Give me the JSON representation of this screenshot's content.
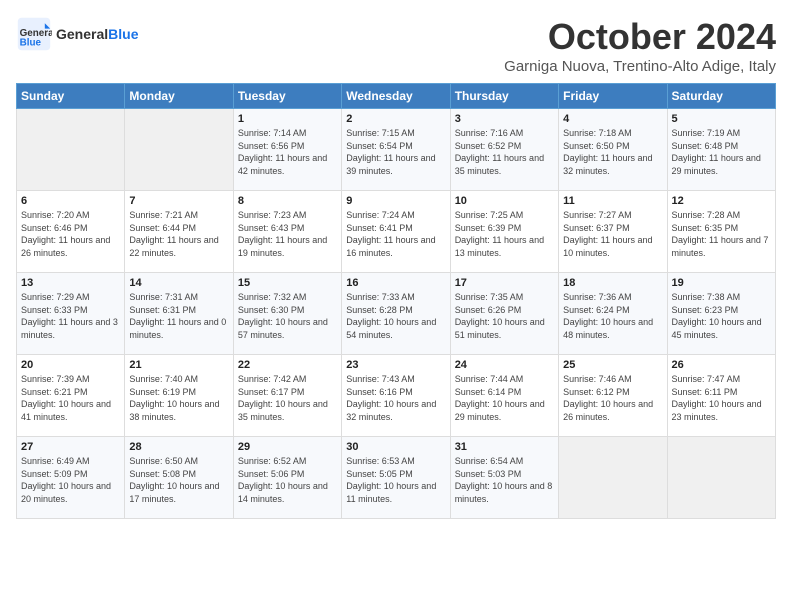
{
  "header": {
    "logo_general": "General",
    "logo_blue": "Blue",
    "month": "October 2024",
    "subtitle": "Garniga Nuova, Trentino-Alto Adige, Italy"
  },
  "days_of_week": [
    "Sunday",
    "Monday",
    "Tuesday",
    "Wednesday",
    "Thursday",
    "Friday",
    "Saturday"
  ],
  "weeks": [
    [
      {
        "day": "",
        "info": ""
      },
      {
        "day": "",
        "info": ""
      },
      {
        "day": "1",
        "info": "Sunrise: 7:14 AM\nSunset: 6:56 PM\nDaylight: 11 hours and 42 minutes."
      },
      {
        "day": "2",
        "info": "Sunrise: 7:15 AM\nSunset: 6:54 PM\nDaylight: 11 hours and 39 minutes."
      },
      {
        "day": "3",
        "info": "Sunrise: 7:16 AM\nSunset: 6:52 PM\nDaylight: 11 hours and 35 minutes."
      },
      {
        "day": "4",
        "info": "Sunrise: 7:18 AM\nSunset: 6:50 PM\nDaylight: 11 hours and 32 minutes."
      },
      {
        "day": "5",
        "info": "Sunrise: 7:19 AM\nSunset: 6:48 PM\nDaylight: 11 hours and 29 minutes."
      }
    ],
    [
      {
        "day": "6",
        "info": "Sunrise: 7:20 AM\nSunset: 6:46 PM\nDaylight: 11 hours and 26 minutes."
      },
      {
        "day": "7",
        "info": "Sunrise: 7:21 AM\nSunset: 6:44 PM\nDaylight: 11 hours and 22 minutes."
      },
      {
        "day": "8",
        "info": "Sunrise: 7:23 AM\nSunset: 6:43 PM\nDaylight: 11 hours and 19 minutes."
      },
      {
        "day": "9",
        "info": "Sunrise: 7:24 AM\nSunset: 6:41 PM\nDaylight: 11 hours and 16 minutes."
      },
      {
        "day": "10",
        "info": "Sunrise: 7:25 AM\nSunset: 6:39 PM\nDaylight: 11 hours and 13 minutes."
      },
      {
        "day": "11",
        "info": "Sunrise: 7:27 AM\nSunset: 6:37 PM\nDaylight: 11 hours and 10 minutes."
      },
      {
        "day": "12",
        "info": "Sunrise: 7:28 AM\nSunset: 6:35 PM\nDaylight: 11 hours and 7 minutes."
      }
    ],
    [
      {
        "day": "13",
        "info": "Sunrise: 7:29 AM\nSunset: 6:33 PM\nDaylight: 11 hours and 3 minutes."
      },
      {
        "day": "14",
        "info": "Sunrise: 7:31 AM\nSunset: 6:31 PM\nDaylight: 11 hours and 0 minutes."
      },
      {
        "day": "15",
        "info": "Sunrise: 7:32 AM\nSunset: 6:30 PM\nDaylight: 10 hours and 57 minutes."
      },
      {
        "day": "16",
        "info": "Sunrise: 7:33 AM\nSunset: 6:28 PM\nDaylight: 10 hours and 54 minutes."
      },
      {
        "day": "17",
        "info": "Sunrise: 7:35 AM\nSunset: 6:26 PM\nDaylight: 10 hours and 51 minutes."
      },
      {
        "day": "18",
        "info": "Sunrise: 7:36 AM\nSunset: 6:24 PM\nDaylight: 10 hours and 48 minutes."
      },
      {
        "day": "19",
        "info": "Sunrise: 7:38 AM\nSunset: 6:23 PM\nDaylight: 10 hours and 45 minutes."
      }
    ],
    [
      {
        "day": "20",
        "info": "Sunrise: 7:39 AM\nSunset: 6:21 PM\nDaylight: 10 hours and 41 minutes."
      },
      {
        "day": "21",
        "info": "Sunrise: 7:40 AM\nSunset: 6:19 PM\nDaylight: 10 hours and 38 minutes."
      },
      {
        "day": "22",
        "info": "Sunrise: 7:42 AM\nSunset: 6:17 PM\nDaylight: 10 hours and 35 minutes."
      },
      {
        "day": "23",
        "info": "Sunrise: 7:43 AM\nSunset: 6:16 PM\nDaylight: 10 hours and 32 minutes."
      },
      {
        "day": "24",
        "info": "Sunrise: 7:44 AM\nSunset: 6:14 PM\nDaylight: 10 hours and 29 minutes."
      },
      {
        "day": "25",
        "info": "Sunrise: 7:46 AM\nSunset: 6:12 PM\nDaylight: 10 hours and 26 minutes."
      },
      {
        "day": "26",
        "info": "Sunrise: 7:47 AM\nSunset: 6:11 PM\nDaylight: 10 hours and 23 minutes."
      }
    ],
    [
      {
        "day": "27",
        "info": "Sunrise: 6:49 AM\nSunset: 5:09 PM\nDaylight: 10 hours and 20 minutes."
      },
      {
        "day": "28",
        "info": "Sunrise: 6:50 AM\nSunset: 5:08 PM\nDaylight: 10 hours and 17 minutes."
      },
      {
        "day": "29",
        "info": "Sunrise: 6:52 AM\nSunset: 5:06 PM\nDaylight: 10 hours and 14 minutes."
      },
      {
        "day": "30",
        "info": "Sunrise: 6:53 AM\nSunset: 5:05 PM\nDaylight: 10 hours and 11 minutes."
      },
      {
        "day": "31",
        "info": "Sunrise: 6:54 AM\nSunset: 5:03 PM\nDaylight: 10 hours and 8 minutes."
      },
      {
        "day": "",
        "info": ""
      },
      {
        "day": "",
        "info": ""
      }
    ]
  ]
}
